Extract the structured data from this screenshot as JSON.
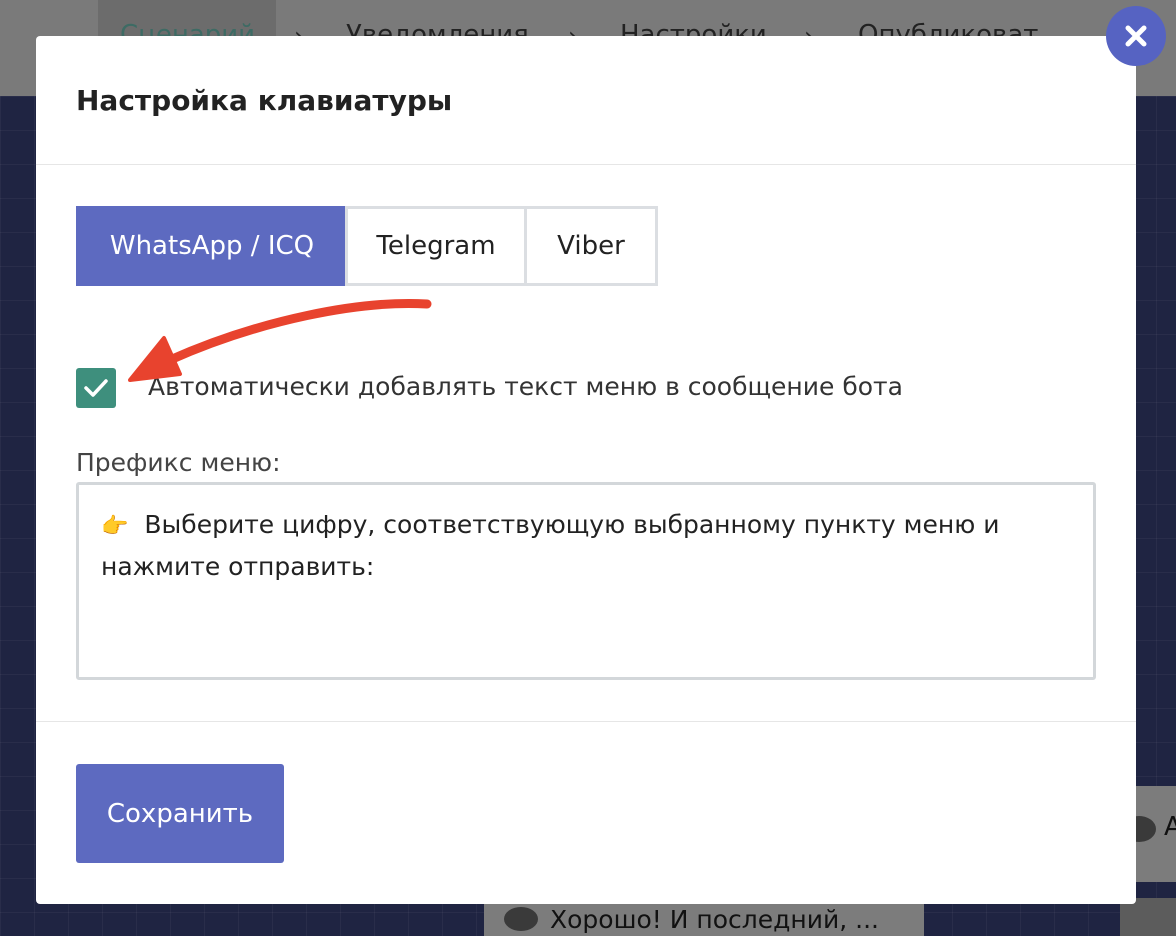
{
  "background": {
    "steps": [
      "Сценарий",
      "Уведомления",
      "Настройки",
      "Опубликоват"
    ],
    "node_text": "Хорошо! И последний, ...",
    "right_node_char": "А"
  },
  "modal": {
    "title": "Настройка клавиатуры",
    "tabs": [
      {
        "label": "WhatsApp / ICQ",
        "active": true
      },
      {
        "label": "Telegram",
        "active": false
      },
      {
        "label": "Viber",
        "active": false
      }
    ],
    "auto_menu_checkbox": {
      "label": "Автоматически добавлять текст меню в сообщение бота",
      "checked": true
    },
    "prefix_field": {
      "label": "Префикс меню:",
      "emoji": "👉",
      "value": "Выберите цифру, соответствующую выбранному пункту меню и нажмите отправить:"
    },
    "save_label": "Сохранить"
  },
  "colors": {
    "accent": "#5d6ac0",
    "checkbox": "#3e8f7d",
    "annotation_arrow": "#e8432e"
  }
}
